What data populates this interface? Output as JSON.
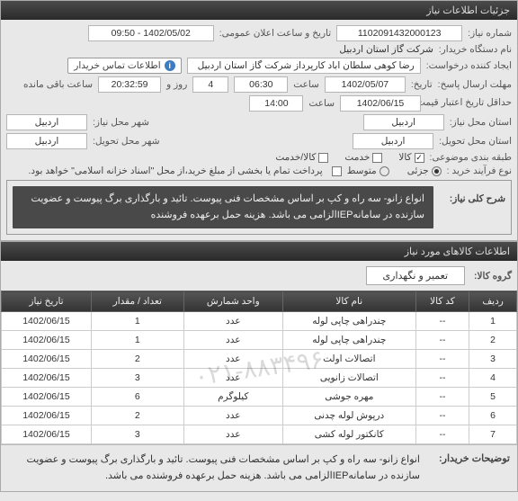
{
  "panel1": {
    "title": "جزئیات اطلاعات نیاز",
    "need_no_lbl": "شماره نیاز:",
    "need_no": "1102091432000123",
    "announce_dt_lbl": "تاریخ و ساعت اعلان عمومی:",
    "announce_dt": "1402/05/02 - 09:50",
    "buyer_lbl": "نام دستگاه خریدار:",
    "buyer": "شرکت گاز استان اردبیل",
    "creator_lbl": "ایجاد کننده درخواست:",
    "creator": "رضا کوهی سلطان اباد کارپرداز شرکت گاز استان اردبیل",
    "contact_tab": "اطلاعات تماس خریدار",
    "deadline_lbl": "مهلت ارسال پاسخ:",
    "deadline_lbl2": "تاریخ:",
    "deadline_date": "1402/05/07",
    "deadline_time_lbl": "ساعت",
    "deadline_time": "06:30",
    "days_left": "4",
    "days_left_lbl": "روز و",
    "time_left": "20:32:59",
    "time_left_lbl": "ساعت باقی مانده",
    "credit_lbl": "حداقل تاریخ اعتبار قیمت تا تاریخ:",
    "credit_date": "1402/06/15",
    "credit_time_lbl": "ساعت",
    "credit_time": "14:00",
    "loc_need_lbl": "استان محل نیاز:",
    "loc_need": "اردبیل",
    "city_need_lbl": "شهر محل نیاز:",
    "city_need": "اردبیل",
    "loc_deliv_lbl": "استان محل تحویل:",
    "loc_deliv": "اردبیل",
    "city_deliv_lbl": "شهر محل تحویل:",
    "city_deliv": "اردبیل",
    "cat_lbl": "طبقه بندی موضوعی:",
    "cat_goods": "کالا",
    "cat_service": "خدمت",
    "cat_both": "کالا/خدمت",
    "proc_lbl": "نوع فرآیند خرید :",
    "proc_partial": "جزئی",
    "proc_medium": "متوسط",
    "proc_note": "پرداخت تمام یا بخشی از مبلغ خرید،از محل \"اسناد خزانه اسلامی\" خواهد بود.",
    "desc_lbl": "شرح کلی نیاز:",
    "desc_txt": "انواع زانو- سه راه و کپ بر اساس مشخصات فنی پیوست. تائید و بارگذاری برگ پیوست و عضویت سازنده در سامانهIEPالزامی می باشد. هزینه حمل برعهده فروشنده"
  },
  "panel2": {
    "title": "اطلاعات کالاهای مورد نیاز",
    "group_lbl": "گروه کالا:",
    "group_val": "تعمیر و نگهداری",
    "cols": [
      "ردیف",
      "کد کالا",
      "نام کالا",
      "واحد شمارش",
      "تعداد / مقدار",
      "تاریخ نیاز"
    ],
    "rows": [
      [
        "1",
        "--",
        "چندراهی چاپی لوله",
        "عدد",
        "1",
        "1402/06/15"
      ],
      [
        "2",
        "--",
        "چندراهی چاپی لوله",
        "عدد",
        "1",
        "1402/06/15"
      ],
      [
        "3",
        "--",
        "اتصالات اولت",
        "عدد",
        "2",
        "1402/06/15"
      ],
      [
        "4",
        "--",
        "اتصالات زانویی",
        "عدد",
        "3",
        "1402/06/15"
      ],
      [
        "5",
        "--",
        "مهره جوشی",
        "کیلوگرم",
        "6",
        "1402/06/15"
      ],
      [
        "6",
        "--",
        "درپوش لوله چدنی",
        "عدد",
        "2",
        "1402/06/15"
      ],
      [
        "7",
        "--",
        "کانکتور لوله کشی",
        "عدد",
        "3",
        "1402/06/15"
      ]
    ],
    "watermark": "۰۲۱-۸۸۳۴۹۶",
    "bottom_lbl": "توضیحات خریدار:",
    "bottom_txt": "انواع زانو- سه راه و کپ بر اساس مشخصات فنی پیوست. تائید و بارگذاری برگ پیوست و عضویت سازنده در سامانهIEPالزامی می باشد. هزینه حمل برعهده فروشنده می باشد."
  }
}
